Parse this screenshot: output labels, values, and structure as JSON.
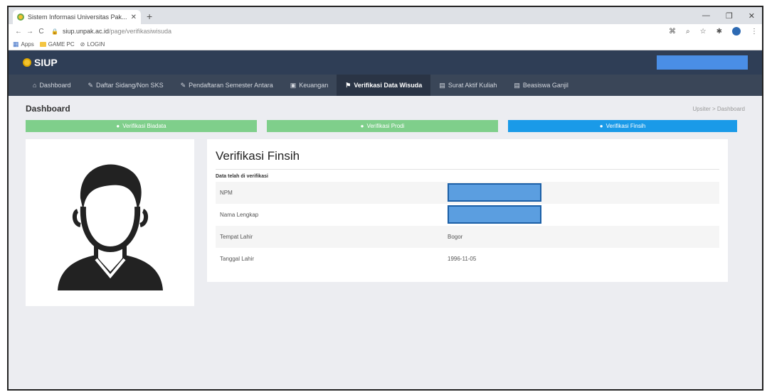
{
  "browser": {
    "tab_title": "Sistem Informasi Universitas Pak...",
    "url_host": "siup.unpak.ac.id",
    "url_path": "/page/verifikasiwisuda",
    "bookmarks": [
      "Apps",
      "GAME PC",
      "LOGIN"
    ]
  },
  "app": {
    "name": "SIUP"
  },
  "nav": {
    "items": [
      {
        "label": "Dashboard",
        "icon": "home-icon"
      },
      {
        "label": "Daftar Sidang/Non SKS",
        "icon": "pin-icon"
      },
      {
        "label": "Pendaftaran Semester Antara",
        "icon": "pin-icon"
      },
      {
        "label": "Keuangan",
        "icon": "money-icon"
      },
      {
        "label": "Verifikasi Data Wisuda",
        "icon": "graduation-icon"
      },
      {
        "label": "Surat Aktif Kuliah",
        "icon": "document-icon"
      },
      {
        "label": "Beasiswa Ganjil",
        "icon": "document-icon"
      }
    ]
  },
  "page": {
    "title": "Dashboard",
    "breadcrumb": "Upsiter > Dashboard"
  },
  "steps": [
    {
      "label": "Verifikasi Biadata",
      "color": "#7fcf8b"
    },
    {
      "label": "Verifikasi Prodi",
      "color": "#7fcf8b"
    },
    {
      "label": "Verifikasi Finsih",
      "color": "#1a9ae8"
    }
  ],
  "verification": {
    "title": "Verifikasi Finsih",
    "subtitle": "Data telah di verifikasi",
    "rows": [
      {
        "label": "NPM",
        "value": ""
      },
      {
        "label": "Nama Lengkap",
        "value": ""
      },
      {
        "label": "Tempat Lahir",
        "value": "Bogor"
      },
      {
        "label": "Tanggal Lahir",
        "value": "1996-11-05"
      }
    ]
  }
}
